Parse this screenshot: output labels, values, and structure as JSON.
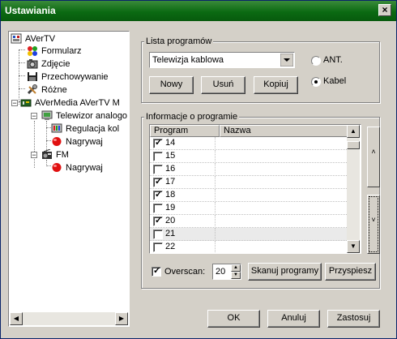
{
  "window": {
    "title": "Ustawiania",
    "close_glyph": "×"
  },
  "tree": {
    "items": [
      {
        "label": "AVerTV",
        "icon": "avertv-icon"
      },
      {
        "label": "Formularz",
        "icon": "form-icon"
      },
      {
        "label": "Zdjęcie",
        "icon": "camera-icon"
      },
      {
        "label": "Przechowywanie",
        "icon": "disk-icon"
      },
      {
        "label": "Różne",
        "icon": "tools-icon"
      },
      {
        "label": "AVerMedia AVerTV M",
        "icon": "device-icon"
      },
      {
        "label": "Telewizor analogo",
        "icon": "tv-icon"
      },
      {
        "label": "Regulacja kol",
        "icon": "color-adjust-icon"
      },
      {
        "label": "Nagrywaj",
        "icon": "record-icon"
      },
      {
        "label": "FM",
        "icon": "radio-icon"
      },
      {
        "label": "Nagrywaj",
        "icon": "record-icon"
      }
    ]
  },
  "program_list": {
    "title": "Lista programów",
    "source_value": "Telewizja kablowa",
    "new_label": "Nowy",
    "delete_label": "Usuń",
    "copy_label": "Kopiuj",
    "antenna_label": "ANT.",
    "cable_label": "Kabel",
    "selected": "Kabel"
  },
  "program_info": {
    "title": "Informacje o programie",
    "col_program": "Program",
    "col_name": "Nazwa",
    "rows": [
      {
        "program": "14",
        "checked": true
      },
      {
        "program": "15",
        "checked": false
      },
      {
        "program": "16",
        "checked": false
      },
      {
        "program": "17",
        "checked": true
      },
      {
        "program": "18",
        "checked": true
      },
      {
        "program": "19",
        "checked": false
      },
      {
        "program": "20",
        "checked": true
      },
      {
        "program": "21",
        "checked": false,
        "selected": true
      },
      {
        "program": "22",
        "checked": false
      }
    ],
    "overscan_label": "Overscan:",
    "overscan_checked": true,
    "overscan_value": "20",
    "scan_label": "Skanuj programy",
    "speedup_label": "Przyspiesz"
  },
  "footer": {
    "ok_label": "OK",
    "cancel_label": "Anuluj",
    "apply_label": "Zastosuj"
  }
}
